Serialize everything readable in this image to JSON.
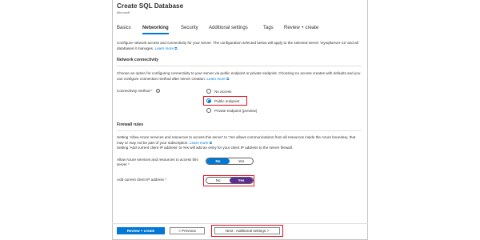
{
  "header": {
    "title": "Create SQL Database",
    "subtitle": "Microsoft"
  },
  "tabs": [
    {
      "label": "Basics",
      "active": false
    },
    {
      "label": "Networking",
      "active": true
    },
    {
      "label": "Security",
      "active": false
    },
    {
      "label": "Additional settings",
      "active": false
    },
    {
      "label": "Tags",
      "active": false
    },
    {
      "label": "Review + create",
      "active": false
    }
  ],
  "intro": {
    "text": "Configure network access and connectivity for your server. The configuration selected below will apply to the selected server 'mysqlserver-12' and all databases it manages.",
    "link": "Learn more"
  },
  "network_connectivity": {
    "heading": "Network connectivity",
    "text": "Choose an option for configuring connectivity to your server via public endpoint or private endpoint. Choosing no access creates with defaults and you can configure connection method after server creation.",
    "link": "Learn more",
    "method_label": "Connectivity method",
    "required_mark": "*",
    "info_icon": "info-icon",
    "options": [
      {
        "label": "No access",
        "checked": false
      },
      {
        "label": "Public endpoint",
        "checked": true
      },
      {
        "label": "Private endpoint (preview)",
        "checked": false
      }
    ]
  },
  "firewall": {
    "heading": "Firewall rules",
    "text1": "Setting 'Allow Azure services and resources to access this server' to 'Yes allows communications from all resources inside the Azure boundary, that may or may not be part of your subscription.",
    "link": "Learn more",
    "text2": "Setting 'Add current client IP address' to Yes will add an entry for your client IP address to the server firewall.",
    "allow_azure_label": "Allow Azure services and resources to access this server",
    "allow_azure_required": "*",
    "allow_azure_value": "No",
    "client_ip_label": "Add current client IP address",
    "client_ip_required": "*",
    "client_ip_value": "Yes",
    "no_label": "No",
    "yes_label": "Yes"
  },
  "footer": {
    "review_create": "Review + create",
    "previous": "< Previous",
    "next": "Next : Additional settings >"
  },
  "colors": {
    "accent": "#0078d4",
    "highlight": "#e81123",
    "toggle_yes_active": "#5c2d91",
    "required": "#a4262c"
  }
}
